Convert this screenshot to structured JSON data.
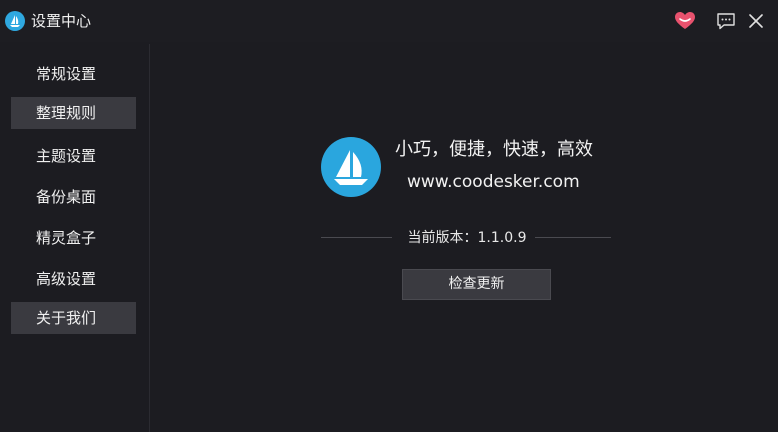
{
  "window": {
    "title": "设置中心",
    "icons": {
      "app": "sailboat-icon",
      "favorite": "heart-icon",
      "feedback": "chat-icon",
      "close": "close-icon"
    }
  },
  "sidebar": {
    "items": [
      {
        "label": "常规设置",
        "active": false
      },
      {
        "label": "整理规则",
        "active": true
      },
      {
        "label": "主题设置",
        "active": false
      },
      {
        "label": "备份桌面",
        "active": false
      },
      {
        "label": "精灵盒子",
        "active": false
      },
      {
        "label": "高级设置",
        "active": false
      },
      {
        "label": "关于我们",
        "active": true
      }
    ]
  },
  "about": {
    "slogan": "小巧，便捷，快速，高效",
    "website": "www.coodesker.com",
    "version_text": "当前版本：1.1.0.9",
    "update_button": "检查更新"
  },
  "colors": {
    "background": "#1c1c21",
    "active_item": "#3a3a40",
    "brand_blue": "#2aa6de",
    "heart": "#e8526e"
  }
}
